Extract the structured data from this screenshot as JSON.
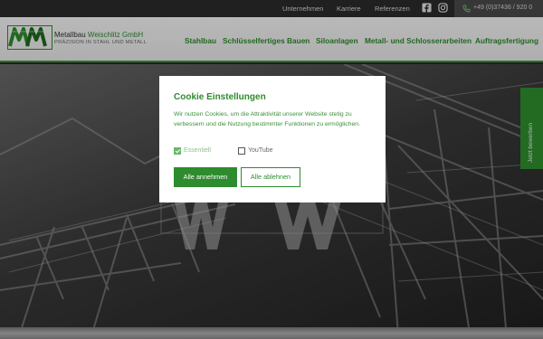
{
  "topbar": {
    "links": [
      "Unternehmen",
      "Karriere",
      "Referenzen"
    ],
    "phone": "+49 (0)37436 / 920 0",
    "icons": [
      "facebook-icon",
      "instagram-icon",
      "phone-icon"
    ]
  },
  "header": {
    "brand_name": "Metallbau",
    "brand_name_accent": "Weischlitz GmbH",
    "tagline": "PRÄZISION IN STAHL UND METALL",
    "nav": [
      "Stahlbau",
      "Schlüsselfertiges Bauen",
      "Siloanlagen",
      "Metall- und Schlosserarbeiten",
      "Auftragsfertigung"
    ]
  },
  "side_tab": {
    "label": "Jetzt bewerben"
  },
  "cookie": {
    "title": "Cookie Einstellungen",
    "text": "Wir nutzen Cookies, um die Attraktivität unserer Website stetig zu verbessern und die Nutzung bestimmter Funktionen zu ermöglichen.",
    "options": [
      {
        "label": "Essentiell",
        "checked": true,
        "disabled": true
      },
      {
        "label": "YouTube",
        "checked": false,
        "disabled": false
      }
    ],
    "accept_label": "Alle annehmen",
    "reject_label": "Alle ablehnen"
  },
  "colors": {
    "brand_green": "#2e8b2e",
    "topbar": "#2b2b2b"
  }
}
